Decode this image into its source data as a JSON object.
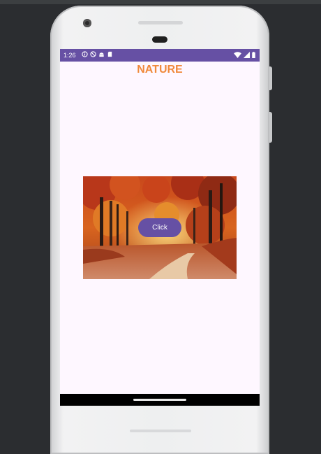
{
  "status_bar": {
    "time": "1:26",
    "left_icons": [
      "info-icon",
      "do-not-disturb-icon",
      "android-icon",
      "sd-card-icon"
    ],
    "right_icons": [
      "wifi-icon",
      "signal-icon"
    ],
    "color": "#6650a4"
  },
  "app": {
    "title": "NATURE",
    "title_color": "#f08a3c",
    "button_label": "Click",
    "button_color": "#6650a4",
    "image_description": "autumn-forest-path"
  }
}
